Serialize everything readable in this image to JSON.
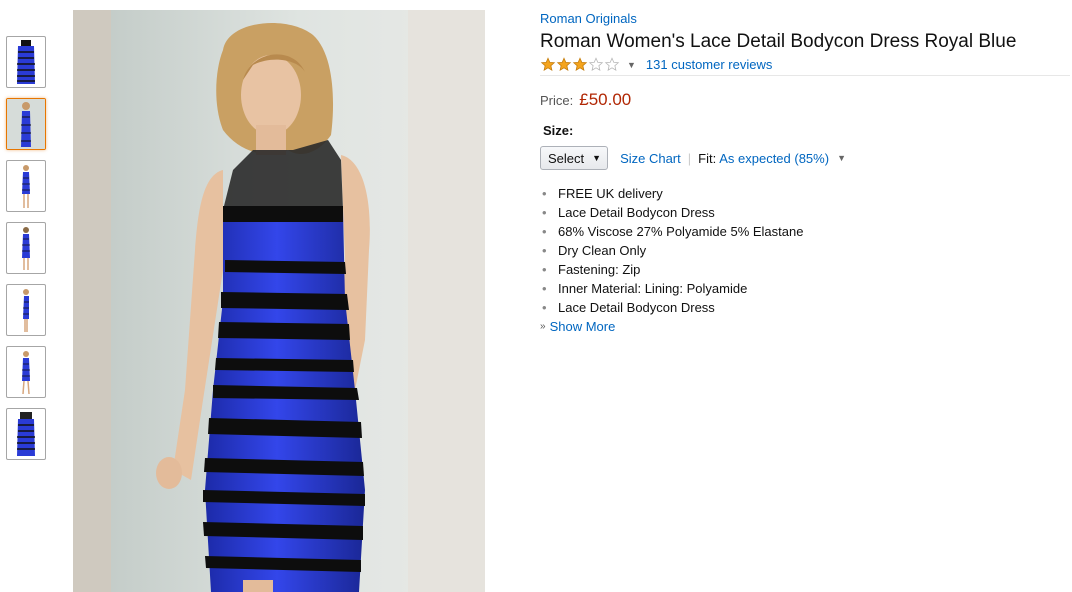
{
  "thumbnails": [
    {
      "name": "thumb-1",
      "selected": false,
      "view": "dress-flat"
    },
    {
      "name": "thumb-2",
      "selected": true,
      "view": "model-front"
    },
    {
      "name": "thumb-3",
      "selected": false,
      "view": "model-full"
    },
    {
      "name": "thumb-4",
      "selected": false,
      "view": "model-back"
    },
    {
      "name": "thumb-5",
      "selected": false,
      "view": "model-side"
    },
    {
      "name": "thumb-6",
      "selected": false,
      "view": "model-full-2"
    },
    {
      "name": "thumb-7",
      "selected": false,
      "view": "dress-detail"
    }
  ],
  "product": {
    "brand": "Roman Originals",
    "title": "Roman Women's Lace Detail Bodycon Dress Royal Blue",
    "rating": 3,
    "rating_max": 5,
    "reviews_text": "131 customer reviews",
    "price_label": "Price:",
    "price": "£50.00",
    "size_label": "Size:",
    "size_select": "Select",
    "size_chart": "Size Chart",
    "fit_label": "Fit:",
    "fit_value": "As expected (85%)",
    "bullets": [
      "FREE UK delivery",
      "Lace Detail Bodycon Dress",
      "68% Viscose 27% Polyamide 5% Elastane",
      "Dry Clean Only",
      "Fastening: Zip",
      "Inner Material: Lining: Polyamide",
      "Lace Detail Bodycon Dress"
    ],
    "show_more": "Show More"
  },
  "colors": {
    "link": "#0066c0",
    "price": "#b12704",
    "star": "#f4a41d",
    "selected_border": "#e77600",
    "dress_blue": "#2a3bd6",
    "lace_black": "#111111"
  },
  "icons": {
    "star": "star-icon",
    "caret": "caret-down-icon",
    "show_more": "chevron-double-down-icon"
  }
}
